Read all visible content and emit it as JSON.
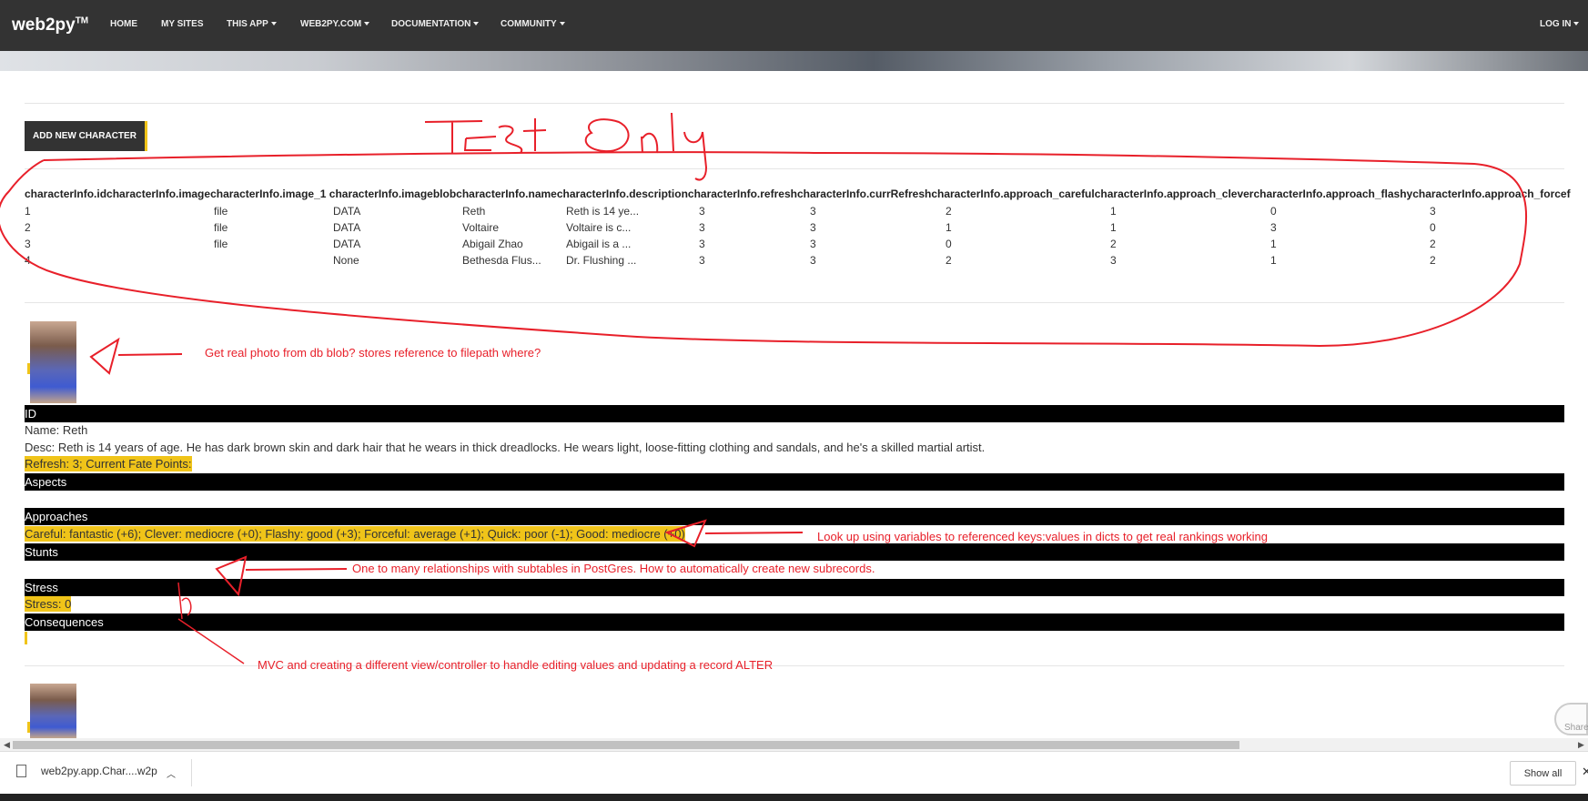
{
  "navbar": {
    "brand": "web2py",
    "brand_tm": "TM",
    "items": [
      "HOME",
      "MY SITES",
      "THIS APP",
      "WEB2PY.COM",
      "DOCUMENTATION",
      "COMMUNITY"
    ],
    "login": "LOG IN"
  },
  "add_button": "ADD NEW CHARACTER",
  "table": {
    "header": "characterInfo.idcharacterInfo.imagecharacterInfo.image_1 characterInfo.imageblobcharacterInfo.namecharacterInfo.descriptioncharacterInfo.refreshcharacterInfo.currRefreshcharacterInfo.approach_carefulcharacterInfo.approach_clevercharacterInfo.approach_flashycharacterInfo.approach_forcef",
    "rows": [
      {
        "id": "1",
        "image": "file",
        "blob": "DATA",
        "name": "Reth",
        "desc": "Reth is 14 ye...",
        "refresh": "3",
        "curr": "3",
        "careful": "2",
        "clever": "1",
        "flashy": "0",
        "forceful": "3"
      },
      {
        "id": "2",
        "image": "file",
        "blob": "DATA",
        "name": "Voltaire",
        "desc": "Voltaire is c...",
        "refresh": "3",
        "curr": "3",
        "careful": "1",
        "clever": "1",
        "flashy": "3",
        "forceful": "0"
      },
      {
        "id": "3",
        "image": "file",
        "blob": "DATA",
        "name": "Abigail Zhao",
        "desc": "Abigail is a ...",
        "refresh": "3",
        "curr": "3",
        "careful": "0",
        "clever": "2",
        "flashy": "1",
        "forceful": "2"
      },
      {
        "id": "4",
        "image": "",
        "blob": "None",
        "name": "Bethesda Flus...",
        "desc": "Dr. Flushing ...",
        "refresh": "3",
        "curr": "3",
        "careful": "2",
        "clever": "3",
        "flashy": "1",
        "forceful": "2"
      }
    ]
  },
  "character": {
    "id_label": "ID",
    "name_line": "Name: Reth",
    "desc_line": "Desc: Reth is 14 years of age. He has dark brown skin and dark hair that he wears in thick dreadlocks. He wears light, loose-fitting clothing and sandals, and he's a skilled martial artist.",
    "refresh_line": "Refresh: 3; Current Fate Points:",
    "aspects_label": "Aspects",
    "approaches_label": "Approaches",
    "approaches_line": "Careful: fantastic (+6); Clever: mediocre (+0); Flashy: good (+3); Forceful: average (+1); Quick: poor (-1); Good: mediocre (+0)",
    "stunts_label": "Stunts",
    "stress_label": "Stress",
    "stress_line": "Stress: 0",
    "consequences_label": "Consequences"
  },
  "annotations": {
    "title": "Test only",
    "note_photo": "Get real photo from db blob? stores reference to filepath where?",
    "note_lookup": "Look up using variables to referenced  keys:values in dicts to get real rankings working",
    "note_one_to_many": "One to many relationships with subtables in PostGres. How to automatically create new subrecords.",
    "note_mvc": "MVC and creating a different view/controller to handle editing values and updating a record ALTER"
  },
  "share_label": "Share",
  "downloads": {
    "file": "web2py.app.Char....w2p",
    "show_all": "Show all"
  },
  "colors": {
    "navbar": "#333333",
    "highlight": "#f0c419",
    "annotation": "#e8202a"
  }
}
